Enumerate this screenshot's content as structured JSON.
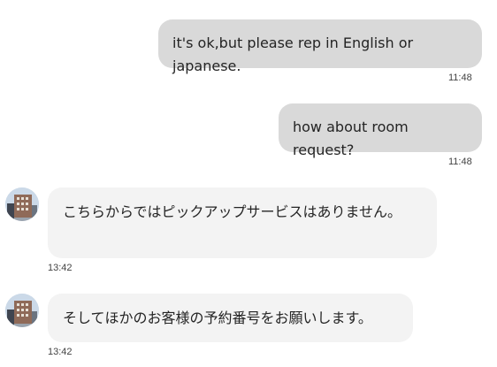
{
  "messages": [
    {
      "direction": "outgoing",
      "text": "it's ok,but please rep in English or japanese.",
      "time": "11:48"
    },
    {
      "direction": "outgoing",
      "text": "how about room request?",
      "time": "11:48"
    },
    {
      "direction": "incoming",
      "avatar_icon": "hotel-building-avatar",
      "text": "こちらからではピックアップサービスはありません。",
      "time": "13:42"
    },
    {
      "direction": "incoming",
      "avatar_icon": "hotel-building-avatar",
      "text": "そしてほかのお客様の予約番号をお願いします。",
      "time": "13:42"
    }
  ],
  "colors": {
    "outgoing_bubble": "#d9d9d9",
    "incoming_bubble": "#f3f3f3",
    "text": "#242424",
    "timestamp": "#424242"
  }
}
